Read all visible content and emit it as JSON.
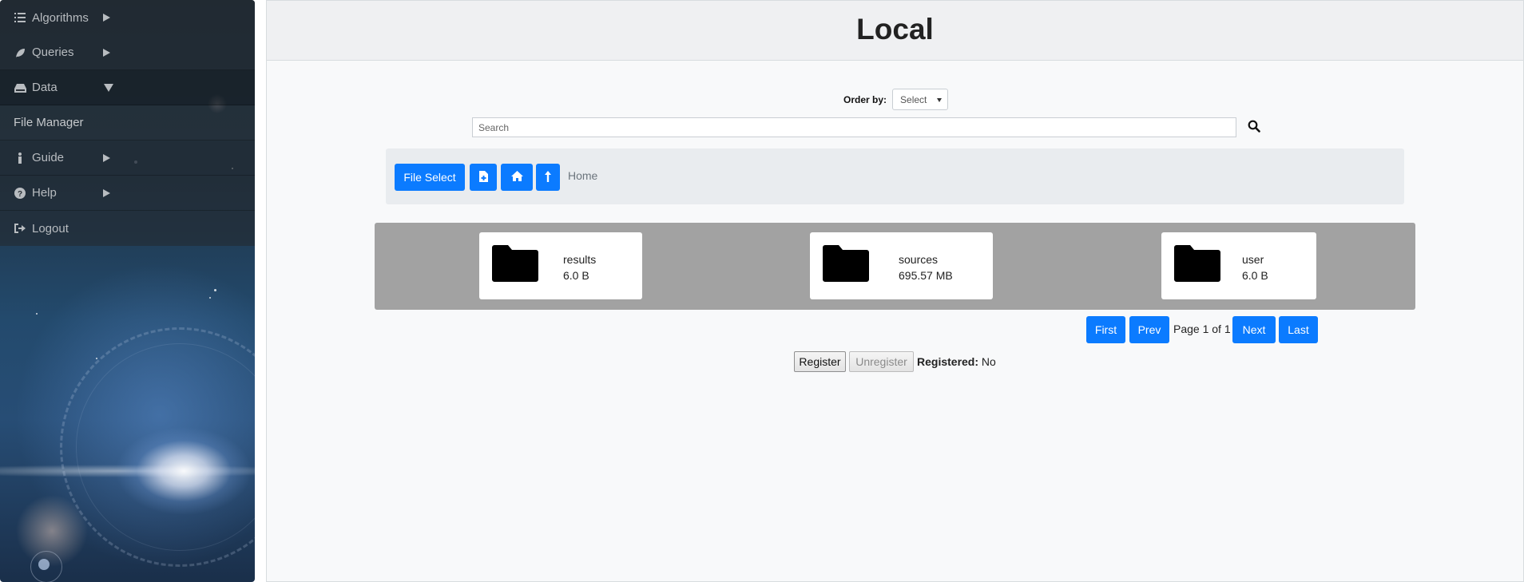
{
  "sidebar": {
    "items": [
      {
        "label": "Algorithms",
        "icon": "list-icon"
      },
      {
        "label": "Queries",
        "icon": "leaf-icon"
      },
      {
        "label": "Data",
        "icon": "hdd-icon"
      },
      {
        "label": "File Manager"
      },
      {
        "label": "Guide",
        "icon": "info-icon"
      },
      {
        "label": "Help",
        "icon": "question-circle-icon"
      },
      {
        "label": "Logout",
        "icon": "sign-out-icon"
      }
    ]
  },
  "main": {
    "title": "Local",
    "order_by": {
      "label": "Order by:",
      "selected": "Select"
    },
    "search": {
      "placeholder": "Search",
      "icon": "search-icon"
    },
    "toolbar": {
      "file_select": "File Select",
      "new_file_icon": "file-plus-icon",
      "home_icon": "home-icon",
      "up_icon": "arrow-up-icon",
      "breadcrumb": "Home"
    },
    "files": [
      {
        "name": "results",
        "size": "6.0 B",
        "icon": "folder-icon"
      },
      {
        "name": "sources",
        "size": "695.57 MB",
        "icon": "folder-icon"
      },
      {
        "name": "user",
        "size": "6.0 B",
        "icon": "folder-icon"
      }
    ],
    "pagination": {
      "first": "First",
      "prev": "Prev",
      "status": "Page 1 of 1",
      "next": "Next",
      "last": "Last"
    },
    "register": {
      "register": "Register",
      "unregister": "Unregister",
      "label": "Registered:",
      "value": "No"
    }
  },
  "colors": {
    "accent": "#0b7bff",
    "files_bg": "#a2a2a2",
    "sidebar_text": "#b8bcc0"
  }
}
